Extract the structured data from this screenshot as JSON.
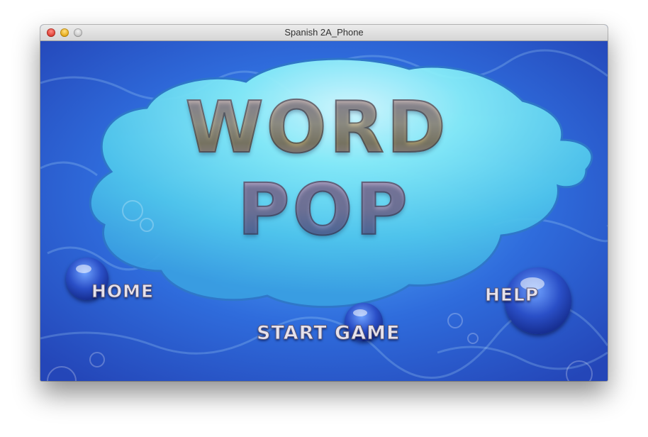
{
  "window": {
    "title": "Spanish 2A_Phone"
  },
  "logo": {
    "line1": "WORD",
    "line2": "POP"
  },
  "menu": {
    "home_label": "HOME",
    "help_label": "HELP",
    "start_label": "START GAME"
  },
  "colors": {
    "ocean": "#2f66d8",
    "cloud": "#5fd6ee",
    "bubble": "#2a4fc7",
    "label": "#e6e2ec"
  }
}
